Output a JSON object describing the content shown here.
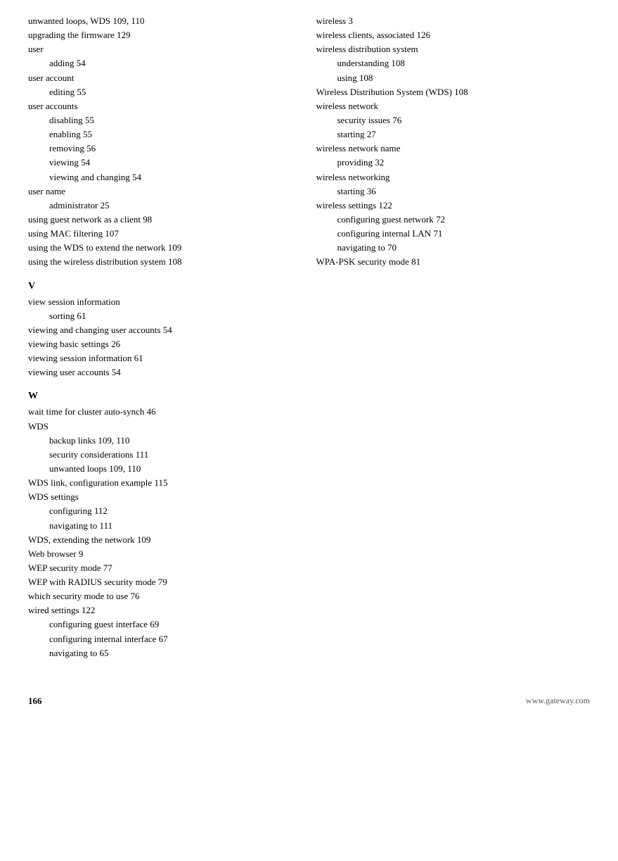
{
  "left_column": {
    "entries": [
      {
        "level": "top",
        "text": "unwanted loops, WDS  109,  110"
      },
      {
        "level": "top",
        "text": "upgrading the firmware  129"
      },
      {
        "level": "top",
        "text": "user"
      },
      {
        "level": "sub",
        "text": "adding  54"
      },
      {
        "level": "top",
        "text": "user account"
      },
      {
        "level": "sub",
        "text": "editing  55"
      },
      {
        "level": "top",
        "text": "user accounts"
      },
      {
        "level": "sub",
        "text": "disabling  55"
      },
      {
        "level": "sub",
        "text": "enabling  55"
      },
      {
        "level": "sub",
        "text": "removing  56"
      },
      {
        "level": "sub",
        "text": "viewing  54"
      },
      {
        "level": "sub",
        "text": "viewing and changing  54"
      },
      {
        "level": "top",
        "text": "user name"
      },
      {
        "level": "sub",
        "text": "administrator  25"
      },
      {
        "level": "top",
        "text": "using guest network as a client  98"
      },
      {
        "level": "top",
        "text": "using MAC filtering  107"
      },
      {
        "level": "top",
        "text": "using the WDS to extend the network  109"
      },
      {
        "level": "top",
        "text": "using the wireless distribution system  108"
      }
    ],
    "sections": [
      {
        "letter": "V",
        "entries": [
          {
            "level": "top",
            "text": "view session information"
          },
          {
            "level": "sub",
            "text": "sorting  61"
          },
          {
            "level": "top",
            "text": "viewing and changing user accounts  54"
          },
          {
            "level": "top",
            "text": "viewing basic settings  26"
          },
          {
            "level": "top",
            "text": "viewing session information  61"
          },
          {
            "level": "top",
            "text": "viewing user accounts  54"
          }
        ]
      },
      {
        "letter": "W",
        "entries": [
          {
            "level": "top",
            "text": "wait time for cluster auto-synch  46"
          },
          {
            "level": "top",
            "text": "WDS"
          },
          {
            "level": "sub",
            "text": "backup links  109,  110"
          },
          {
            "level": "sub",
            "text": "security considerations  111"
          },
          {
            "level": "sub",
            "text": "unwanted loops  109,  110"
          },
          {
            "level": "top",
            "text": "WDS link, configuration example  115"
          },
          {
            "level": "top",
            "text": "WDS settings"
          },
          {
            "level": "sub",
            "text": "configuring  112"
          },
          {
            "level": "sub",
            "text": "navigating to  111"
          },
          {
            "level": "top",
            "text": "WDS, extending the network  109"
          },
          {
            "level": "top",
            "text": "Web browser  9"
          },
          {
            "level": "top",
            "text": "WEP security mode  77"
          },
          {
            "level": "top",
            "text": "WEP with RADIUS security mode  79"
          },
          {
            "level": "top",
            "text": "which security mode to use  76"
          },
          {
            "level": "top",
            "text": "wired settings  122"
          },
          {
            "level": "sub",
            "text": "configuring guest interface  69"
          },
          {
            "level": "sub",
            "text": "configuring internal interface  67"
          },
          {
            "level": "sub",
            "text": "navigating to  65"
          }
        ]
      }
    ]
  },
  "right_column": {
    "entries": [
      {
        "level": "top",
        "text": "wireless  3"
      },
      {
        "level": "top",
        "text": "wireless clients, associated  126"
      },
      {
        "level": "top",
        "text": "wireless distribution system"
      },
      {
        "level": "sub",
        "text": "understanding  108"
      },
      {
        "level": "sub",
        "text": "using  108"
      },
      {
        "level": "top",
        "text": "Wireless Distribution System (WDS)  108"
      },
      {
        "level": "top",
        "text": "wireless network"
      },
      {
        "level": "sub",
        "text": "security issues  76"
      },
      {
        "level": "sub",
        "text": "starting  27"
      },
      {
        "level": "top",
        "text": "wireless network name"
      },
      {
        "level": "sub",
        "text": "providing  32"
      },
      {
        "level": "top",
        "text": "wireless networking"
      },
      {
        "level": "sub",
        "text": "starting  36"
      },
      {
        "level": "top",
        "text": "wireless settings  122"
      },
      {
        "level": "sub",
        "text": "configuring guest network  72"
      },
      {
        "level": "sub",
        "text": "configuring internal LAN  71"
      },
      {
        "level": "sub",
        "text": "navigating to  70"
      },
      {
        "level": "top",
        "text": "WPA-PSK security mode  81"
      }
    ]
  },
  "footer": {
    "page_number": "166",
    "url": "www.gateway.com"
  }
}
